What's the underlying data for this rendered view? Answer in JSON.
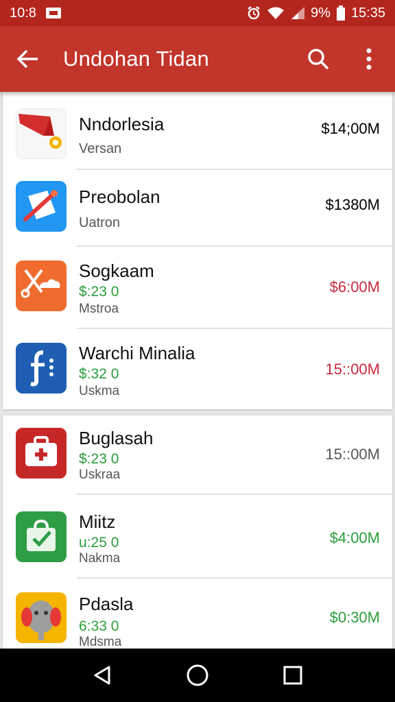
{
  "status_bar": {
    "time": "10:8",
    "battery_text": "9%",
    "clock": "15:35"
  },
  "app_bar": {
    "title": "Undohan Tidan",
    "color": "#c1352b"
  },
  "items": [
    {
      "name": "Nndorlesia",
      "price": "",
      "sub": "Versan",
      "amount": "$14;00M",
      "amount_color": "#555555",
      "icon": "megaphone-icon"
    },
    {
      "name": "Preobolan",
      "price": "",
      "sub": "Uatron",
      "amount": "$1380M",
      "amount_color": "#555555",
      "icon": "rocket-icon"
    },
    {
      "name": "Sogkaam",
      "price": "$:23  0",
      "sub": "Mstroa",
      "amount": "$6:00M",
      "amount_color": "#c8283c",
      "icon": "scissors-cloud-icon"
    },
    {
      "name": "Warchi Minalia",
      "price": "$:32  0",
      "sub": "Uskma",
      "amount": "15::00M",
      "amount_color": "#c8283c",
      "icon": "f-dots-icon"
    },
    {
      "name": "Buglasah",
      "price": "$:23  0",
      "sub": "Uskraa",
      "amount": "15::00M",
      "amount_color": "#555555",
      "icon": "medkit-icon"
    },
    {
      "name": "Miitz",
      "price": "u:25  0",
      "sub": "Nakma",
      "amount": "$4:00M",
      "amount_color": "#2a9d3a",
      "icon": "shopping-bag-icon"
    },
    {
      "name": "Pdasla",
      "price": "6:33  0",
      "sub": "Mdsma",
      "amount": "$0:30M",
      "amount_color": "#2a9d3a",
      "icon": "elephant-icon"
    }
  ]
}
